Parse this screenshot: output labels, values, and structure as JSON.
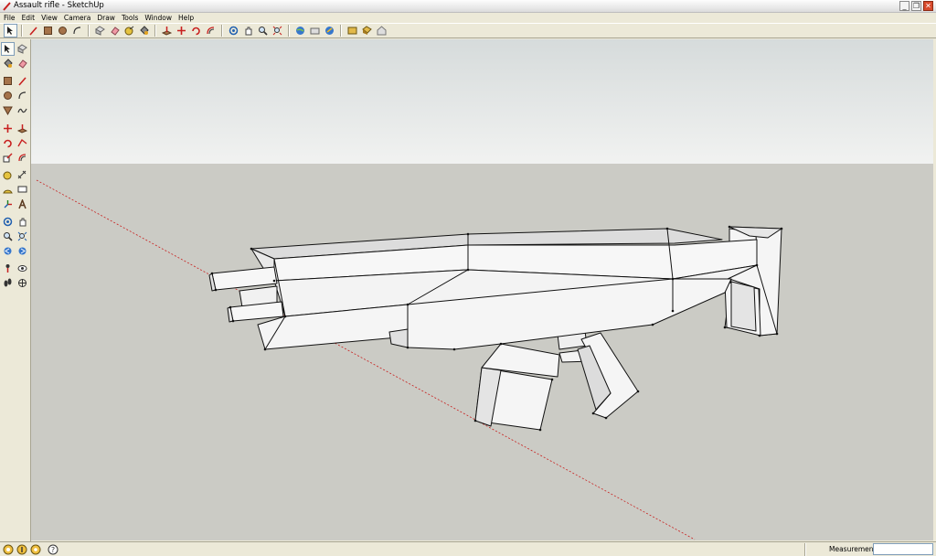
{
  "window": {
    "title": "Assault rifle - SketchUp",
    "controls": [
      "minimize",
      "restore",
      "close"
    ]
  },
  "menubar": {
    "items": [
      "File",
      "Edit",
      "View",
      "Camera",
      "Draw",
      "Tools",
      "Window",
      "Help"
    ]
  },
  "toolbar": {
    "icons": [
      "select-icon",
      "line-icon",
      "rectangle-icon",
      "circle-icon",
      "arc-icon",
      "make-component-icon",
      "eraser-icon",
      "tape-measure-icon",
      "paint-bucket-icon",
      "push-pull-icon",
      "move-icon",
      "rotate-icon",
      "offset-icon",
      "orbit-icon",
      "pan-icon",
      "zoom-icon",
      "zoom-extents-icon",
      "google-earth-icon",
      "get-models-icon",
      "share-model-icon",
      "photo-textures-icon",
      "components-icon",
      "warehouse-icon"
    ]
  },
  "left_toolbar": {
    "icons": [
      "select-icon",
      "make-component-icon",
      "paint-bucket-icon",
      "eraser-icon",
      "rectangle-icon",
      "line-icon",
      "circle-icon",
      "arc-icon",
      "polygon-icon",
      "freehand-icon",
      "move-icon",
      "push-pull-icon",
      "rotate-icon",
      "follow-me-icon",
      "scale-icon",
      "offset-icon",
      "tape-measure-icon",
      "dimension-icon",
      "protractor-icon",
      "text-icon",
      "axes-icon",
      "3d-text-icon",
      "orbit-icon",
      "pan-icon",
      "zoom-icon",
      "zoom-window-icon",
      "previous-view-icon",
      "next-view-icon",
      "position-camera-icon",
      "look-around-icon",
      "walk-icon",
      "section-plane-icon"
    ]
  },
  "viewport": {
    "sky_color": "#e3e6e6",
    "ground_color": "#cbcbc5",
    "axis_color": "#c8201f",
    "model_name": "assault-rifle-model"
  },
  "statusbar": {
    "measurements_label": "Measurements",
    "measurements_value": "",
    "icons": [
      "geo-location-icon",
      "credits-icon",
      "owner-icon",
      "help-icon"
    ]
  }
}
